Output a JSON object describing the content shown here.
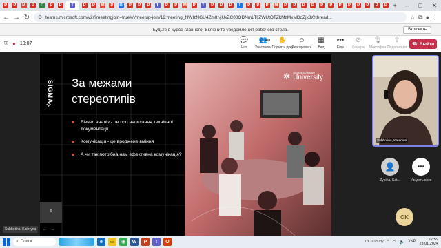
{
  "browser": {
    "tabs": [
      {
        "icon": "pdf-icon",
        "color": "#d93025",
        "glyph": "P"
      },
      {
        "icon": "pdf-icon",
        "color": "#d93025",
        "glyph": "P"
      },
      {
        "icon": "gmail-icon",
        "color": "#ea4335",
        "glyph": "M"
      },
      {
        "icon": "pdf-icon",
        "color": "#d93025",
        "glyph": "P"
      },
      {
        "icon": "drive-icon",
        "color": "#1e8e3e",
        "glyph": "D"
      },
      {
        "icon": "pdf-icon",
        "color": "#d93025",
        "glyph": "P"
      },
      {
        "icon": "pdf-icon",
        "color": "#d93025",
        "glyph": "P"
      },
      {
        "icon": "teams-icon",
        "color": "#5b5fc7",
        "glyph": "T"
      },
      {
        "icon": "pdf-icon",
        "color": "#d93025",
        "glyph": "P"
      },
      {
        "icon": "pdf-icon",
        "color": "#d93025",
        "glyph": "P"
      },
      {
        "icon": "gmail-icon",
        "color": "#ea4335",
        "glyph": "M"
      },
      {
        "icon": "pdf-icon",
        "color": "#d93025",
        "glyph": "P"
      },
      {
        "icon": "docs-icon",
        "color": "#1a73e8",
        "glyph": "D"
      },
      {
        "icon": "pdf-icon",
        "color": "#d93025",
        "glyph": "P"
      },
      {
        "icon": "pdf-icon",
        "color": "#d93025",
        "glyph": "P"
      },
      {
        "icon": "pdf-icon",
        "color": "#d93025",
        "glyph": "P"
      },
      {
        "icon": "teams-icon",
        "color": "#5b5fc7",
        "glyph": "T"
      },
      {
        "icon": "pdf-icon",
        "color": "#d93025",
        "glyph": "P"
      },
      {
        "icon": "pdf-icon",
        "color": "#d93025",
        "glyph": "P"
      },
      {
        "icon": "gmail-icon",
        "color": "#ea4335",
        "glyph": "M"
      },
      {
        "icon": "pdf-icon",
        "color": "#d93025",
        "glyph": "P"
      },
      {
        "icon": "teams-icon",
        "color": "#5b5fc7",
        "glyph": "T"
      },
      {
        "icon": "pdf-icon",
        "color": "#d93025",
        "glyph": "P"
      },
      {
        "icon": "pdf-icon",
        "color": "#d93025",
        "glyph": "P"
      },
      {
        "icon": "pdf-icon",
        "color": "#d93025",
        "glyph": "P"
      },
      {
        "icon": "facebook-icon",
        "color": "#1877f2",
        "glyph": "f"
      },
      {
        "icon": "pdf-icon",
        "color": "#d93025",
        "glyph": "P"
      },
      {
        "icon": "pdf-icon",
        "color": "#d93025",
        "glyph": "P"
      },
      {
        "icon": "pdf-icon",
        "color": "#d93025",
        "glyph": "P"
      },
      {
        "icon": "gmail-icon",
        "color": "#ea4335",
        "glyph": "M"
      },
      {
        "icon": "pdf-icon",
        "color": "#d93025",
        "glyph": "P"
      },
      {
        "icon": "pdf-icon",
        "color": "#d93025",
        "glyph": "P"
      },
      {
        "icon": "pdf-icon",
        "color": "#d93025",
        "glyph": "P"
      },
      {
        "icon": "pdf-icon",
        "color": "#d93025",
        "glyph": "P"
      },
      {
        "icon": "pdf-icon",
        "color": "#d93025",
        "glyph": "P"
      },
      {
        "icon": "pdf-icon",
        "color": "#d93025",
        "glyph": "P"
      },
      {
        "icon": "pdf-icon",
        "color": "#d93025",
        "glyph": "P"
      },
      {
        "icon": "pdf-icon",
        "color": "#d93025",
        "glyph": "P"
      },
      {
        "icon": "pdf-icon",
        "color": "#d93025",
        "glyph": "P"
      },
      {
        "icon": "pdf-icon",
        "color": "#d93025",
        "glyph": "P"
      },
      {
        "icon": "pdf-icon",
        "color": "#d93025",
        "glyph": "P"
      },
      {
        "icon": "pdf-icon",
        "color": "#d93025",
        "glyph": "P"
      }
    ],
    "url": "teams.microsoft.com/v2/?meetingjoin=true#/l/meetup-join/19:meeting_NWIzNGU4ZmItNjUxZC00ODNmLTljZWUtOTZkMzMxMDdZjk3@thread..."
  },
  "notification": {
    "text": "Будьте в курсе главного. Включите уведомления рабочего стола.",
    "button": "Включить"
  },
  "meeting": {
    "timer": "10:07",
    "controls": [
      {
        "icon": "chat-icon",
        "label": "Чат",
        "dim": false
      },
      {
        "icon": "people-icon",
        "label": "Участники",
        "dim": false,
        "badge": "236"
      },
      {
        "icon": "hand-icon",
        "label": "Поднять руку",
        "dim": false
      },
      {
        "icon": "reaction-icon",
        "label": "Реагировать",
        "dim": false
      },
      {
        "icon": "view-icon",
        "label": "Вид",
        "dim": false
      },
      {
        "icon": "more-icon",
        "label": "Еще",
        "dim": false
      }
    ],
    "media": [
      {
        "icon": "camera-icon",
        "label": "Камера",
        "dim": true
      },
      {
        "icon": "mic-icon",
        "label": "Микрофон",
        "dim": true
      },
      {
        "icon": "share-icon",
        "label": "Поделиться",
        "dim": true
      }
    ],
    "leave": "Выйти",
    "presenter": "Subbotina, Kateryna"
  },
  "slide": {
    "brand": "SIGMA",
    "brand_sub": "SOFTWARE",
    "title_line1": "За межами",
    "title_line2": "стереотипів",
    "bullets": [
      "Бізнес аналіз - це про написання технічної документації",
      "Комунікація - це вроджене вміння",
      "А чи так потрібна нам ефективна комунікація?"
    ],
    "page": "6",
    "photo_brand_small": "Sigma Software",
    "photo_brand_big": "University"
  },
  "participants": {
    "self_name": "Subbotina, Kateryna",
    "other_name": "Zybina, Kat...",
    "more_label": "Увидеть всех",
    "ok": "OK"
  },
  "taskbar": {
    "search": "Поиск",
    "weather": "7°C  Cloudy",
    "lang": "УКР",
    "time": "17:59",
    "date": "23.01.2024"
  }
}
